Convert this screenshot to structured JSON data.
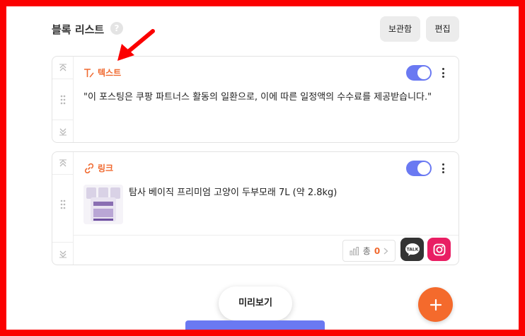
{
  "header": {
    "title": "블록 리스트",
    "help_icon": "?",
    "storage_label": "보관함",
    "edit_label": "편집"
  },
  "blocks": [
    {
      "type_label": "텍스트",
      "type_icon": "text-icon",
      "enabled": true,
      "body": "\"이 포스팅은 쿠팡 파트너스 활동의 일환으로, 이에 따른 일정액의 수수료를 제공받습니다.\""
    },
    {
      "type_label": "링크",
      "type_icon": "link-icon",
      "enabled": true,
      "title": "탐사 베이직 프리미엄 고양이 두부모래 7L (약 2.8kg)",
      "stats_label": "총",
      "stats_count": "0",
      "social": [
        "kakao-talk-icon",
        "instagram-icon"
      ]
    }
  ],
  "footer": {
    "preview_label": "미리보기",
    "add_icon": "plus-icon"
  },
  "colors": {
    "accent": "#f0692f",
    "toggle": "#6a79f2",
    "fab": "#f46a2c",
    "frame": "#fb0000",
    "instagram": "#e91e63"
  }
}
